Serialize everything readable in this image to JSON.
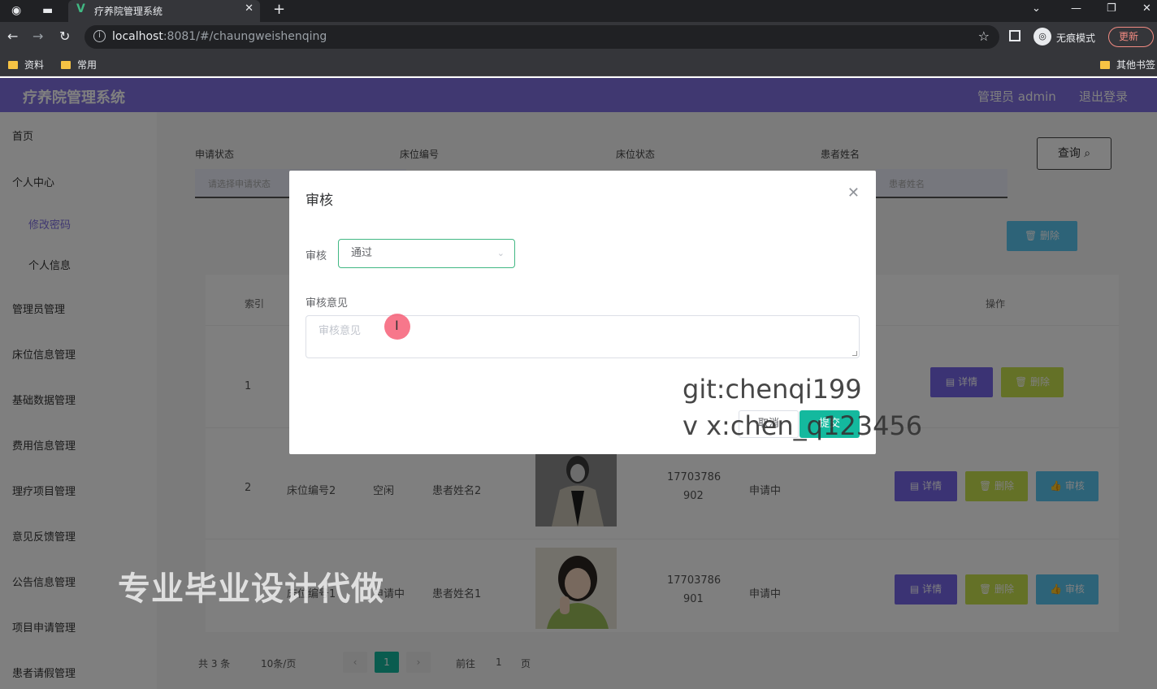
{
  "browser": {
    "tab_title": "疗养院管理系统",
    "url_host": "localhost",
    "url_rest": ":8081/#/chaungweishenqing",
    "incognito_label": "无痕模式",
    "update_label": "更新",
    "bookmarks": [
      "资料",
      "常用"
    ],
    "other_bookmarks": "其他书签"
  },
  "header": {
    "title": "疗养院管理系统",
    "user": "管理员 admin",
    "logout": "退出登录"
  },
  "sidebar": {
    "items": [
      "首页",
      "个人中心",
      "修改密码",
      "个人信息",
      "管理员管理",
      "床位信息管理",
      "基础数据管理",
      "费用信息管理",
      "理疗项目管理",
      "意见反馈管理",
      "公告信息管理",
      "项目申请管理",
      "患者请假管理"
    ]
  },
  "filters": {
    "labels": [
      "申请状态",
      "床位编号",
      "床位状态",
      "患者姓名"
    ],
    "placeholder_left": "请选择申请状态",
    "placeholder_right": "患者姓名",
    "query_label": "查询"
  },
  "toolbar": {
    "delete_label": "删除"
  },
  "table": {
    "headers": {
      "index": "索引",
      "action": "操作"
    },
    "rows": [
      {
        "index": "1",
        "bed": "",
        "status": "",
        "patient": "",
        "phone_a": "",
        "phone_b": "",
        "state": ""
      },
      {
        "index": "2",
        "bed": "床位编号2",
        "status": "空闲",
        "patient": "患者姓名2",
        "phone_a": "17703786",
        "phone_b": "902",
        "state": "申请中"
      },
      {
        "index": "",
        "bed": "床位编号1",
        "status": "申请中",
        "patient": "患者姓名1",
        "phone_a": "17703786",
        "phone_b": "901",
        "state": "申请中"
      }
    ],
    "btn_detail": "详情",
    "btn_delete": "删除",
    "btn_audit": "审核"
  },
  "pager": {
    "total": "共 3 条",
    "page_size": "10条/页",
    "current": "1",
    "goto_prefix": "前往",
    "goto_page": "1",
    "goto_suffix": "页"
  },
  "dialog": {
    "title": "审核",
    "field_label": "审核",
    "select_value": "通过",
    "opinion_label": "审核意见",
    "opinion_placeholder": "审核意见",
    "cancel": "取消",
    "submit": "提交"
  },
  "watermarks": {
    "cn": "专业毕业设计代做",
    "git": "git:chenqi199",
    "vx": "v x:chen_q123456"
  },
  "colors": {
    "header": "#8071e3",
    "accent": "#14b99e",
    "detail": "#7766e8",
    "delete": "#c9e24f",
    "audit": "#5ac6f0"
  }
}
